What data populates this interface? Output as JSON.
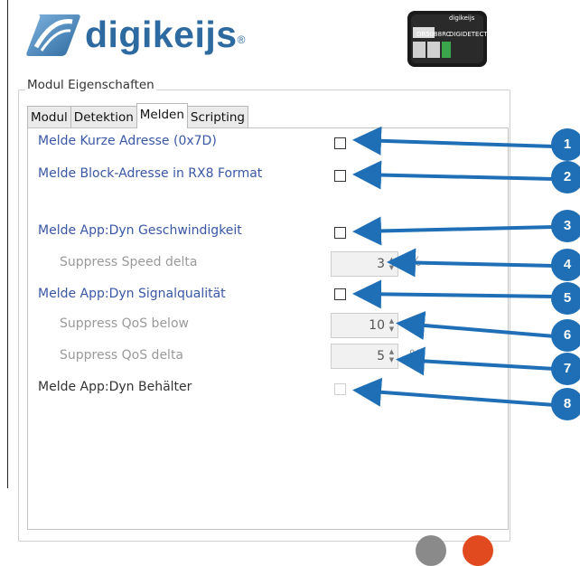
{
  "brand": {
    "name": "digikeijs",
    "reg": "®"
  },
  "device": {
    "label1": "DR5088RC",
    "label2": "DIGIDETECT",
    "brand": "digikeijs"
  },
  "group_title": "Modul Eigenschaften",
  "tabs": [
    {
      "label": "Modul",
      "active": false
    },
    {
      "label": "Detektion",
      "active": false
    },
    {
      "label": "Melden",
      "active": true
    },
    {
      "label": "Scripting",
      "active": false
    }
  ],
  "settings": {
    "kurze_adresse": {
      "label": "Melde Kurze Adresse (0x7D)",
      "checked": false
    },
    "block_adresse": {
      "label": "Melde Block-Adresse in RX8 Format",
      "checked": false
    },
    "dyn_speed": {
      "label": "Melde App:Dyn Geschwindigkeit",
      "checked": false
    },
    "speed_delta": {
      "label": "Suppress Speed delta",
      "value": "3",
      "unit": "%"
    },
    "dyn_signal": {
      "label": "Melde App:Dyn Signalqualität",
      "checked": false
    },
    "qos_below": {
      "label": "Suppress QoS below",
      "value": "10",
      "unit": "%"
    },
    "qos_delta": {
      "label": "Suppress QoS delta",
      "value": "5",
      "unit": "%"
    },
    "dyn_container": {
      "label": "Melde App:Dyn Behälter",
      "checked": false,
      "disabled": true
    }
  },
  "callouts": [
    "1",
    "2",
    "3",
    "4",
    "5",
    "6",
    "7",
    "8"
  ],
  "colors": {
    "accent": "#1e6fb5",
    "label": "#3a57a6",
    "brand": "#2d6aa0"
  }
}
